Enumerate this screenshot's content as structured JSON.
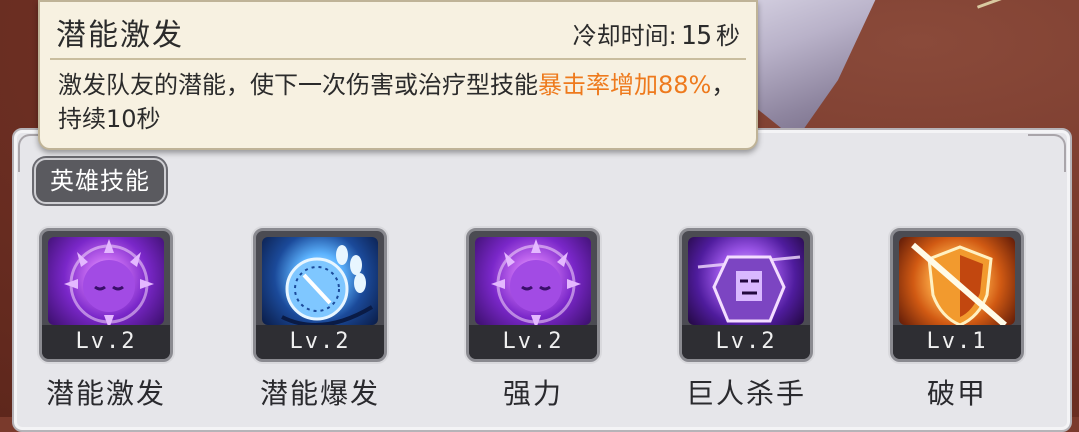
{
  "tooltip": {
    "title": "潜能激发",
    "cooldown_label": "冷却时间:",
    "cooldown_value": "15",
    "cooldown_unit": "秒",
    "desc_prefix": "激发队友的潜能，使下一次伤害或治疗型技能",
    "desc_highlight": "暴击率增加88%",
    "desc_suffix": "，持续10秒"
  },
  "section": {
    "label": "英雄技能"
  },
  "skills": [
    {
      "name": "潜能激发",
      "level": "Lv.2",
      "icon": "sun-face-icon"
    },
    {
      "name": "潜能爆发",
      "level": "Lv.2",
      "icon": "compass-claw-icon"
    },
    {
      "name": "强力",
      "level": "Lv.2",
      "icon": "sun-face-icon"
    },
    {
      "name": "巨人杀手",
      "level": "Lv.2",
      "icon": "golem-icon"
    },
    {
      "name": "破甲",
      "level": "Lv.1",
      "icon": "broken-shield-icon"
    }
  ],
  "colors": {
    "highlight": "#ee7a1d",
    "panel": "#e6e6ea",
    "tooltip": "#f7f1e1"
  }
}
